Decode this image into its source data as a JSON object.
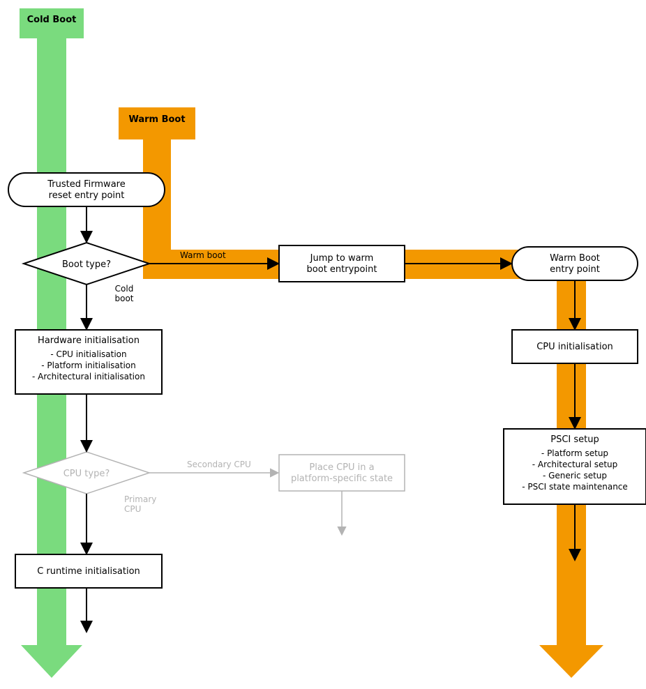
{
  "lanes": {
    "cold": "Cold Boot",
    "warm": "Warm Boot"
  },
  "nodes": {
    "reset": {
      "l1": "Trusted Firmware",
      "l2": "reset entry point"
    },
    "bootType": {
      "l1": "Boot type?"
    },
    "bootTypeEdge": {
      "warm": "Warm boot",
      "cold1": "Cold",
      "cold2": "boot"
    },
    "jumpWarm": {
      "l1": "Jump to warm",
      "l2": "boot entrypoint"
    },
    "warmEntry": {
      "l1": "Warm Boot",
      "l2": "entry point"
    },
    "hwInit": {
      "l1": "Hardware initialisation",
      "l2": "- CPU initialisation",
      "l3": "- Platform initialisation",
      "l4": "- Architectural initialisation"
    },
    "cpuType": {
      "l1": "CPU type?"
    },
    "cpuTypeEdge": {
      "secondary": "Secondary CPU",
      "primary1": "Primary",
      "primary2": "CPU"
    },
    "placeCpu": {
      "l1": "Place CPU in a",
      "l2": "platform-specific state"
    },
    "cRuntime": {
      "l1": "C runtime initialisation"
    },
    "cpuInit": {
      "l1": "CPU initialisation"
    },
    "psci": {
      "l1": "PSCI setup",
      "l2": "- Platform setup",
      "l3": "- Architectural setup",
      "l4": "- Generic setup",
      "l5": "- PSCI state maintenance"
    }
  }
}
